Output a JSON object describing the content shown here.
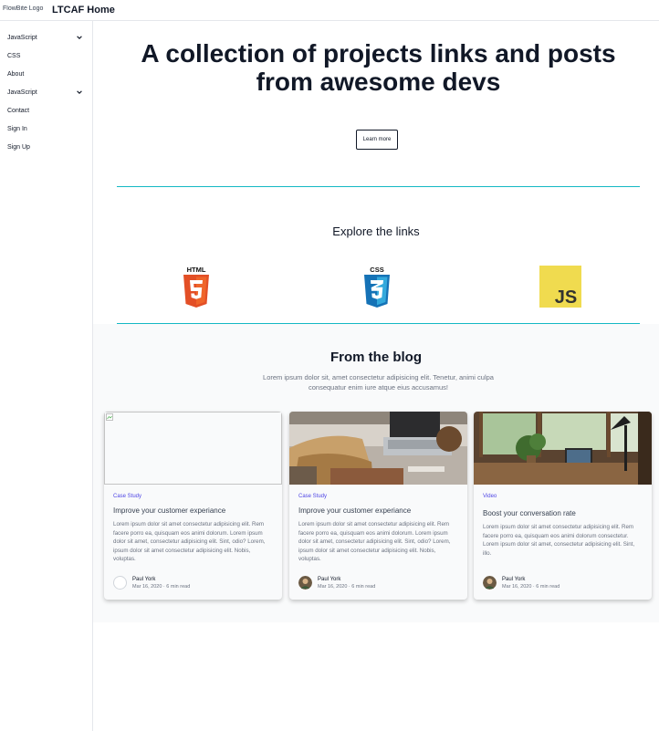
{
  "header": {
    "logo_alt": "FlowBite Logo",
    "brand": "LTCAF Home"
  },
  "sidebar": {
    "items": [
      {
        "label": "JavaScript",
        "has_chevron": true
      },
      {
        "label": "CSS"
      },
      {
        "label": "About"
      },
      {
        "label": "JavaScript",
        "has_chevron": true
      },
      {
        "label": "Contact"
      },
      {
        "label": "Sign In"
      },
      {
        "label": "Sign Up"
      }
    ]
  },
  "hero": {
    "title": "A collection of projects links and posts from awesome devs",
    "button_label": "Learn more"
  },
  "explore": {
    "heading": "Explore the links",
    "icons": [
      {
        "name": "html5-icon",
        "text": "HTML",
        "color": "#e34f26"
      },
      {
        "name": "css3-icon",
        "text": "CSS",
        "color": "#1572b6"
      },
      {
        "name": "js-icon",
        "text": "JS",
        "color": "#f0db4f"
      }
    ]
  },
  "blog": {
    "title": "From the blog",
    "subtitle": "Lorem ipsum dolor sit, amet consectetur adipisicing elit. Tenetur, animi culpa consequatur enim iure atque eius accusamus!",
    "posts": [
      {
        "category": "Case Study",
        "title": "Improve your customer experiance",
        "description": "Lorem ipsum dolor sit amet consectetur adipisicing elit. Rem facere porro ea, quisquam eos animi dolorum. Lorem ipsum dolor sit amet, consectetur adipisicing elit. Sint, odio? Lorem, ipsum dolor sit amet consectetur adipisicing elit. Nobis, voluptas.",
        "author": "Paul York",
        "meta": "Mar 16, 2020 · 6 min read"
      },
      {
        "category": "Case Study",
        "title": "Improve your customer experiance",
        "description": "Lorem ipsum dolor sit amet consectetur adipisicing elit. Rem facere porro ea, quisquam eos animi dolorum. Lorem ipsum dolor sit amet, consectetur adipisicing elit. Sint, odio? Lorem, ipsum dolor sit amet consectetur adipisicing elit. Nobis, voluptas.",
        "author": "Paul York",
        "meta": "Mar 16, 2020 · 6 min read"
      },
      {
        "category": "Video",
        "title": "Boost your conversation rate",
        "description": "Lorem ipsum dolor sit amet consectetur adipisicing elit. Rem facere porro ea, quisquam eos animi dolorum consectetur. Lorem ipsum dolor sit amet, consectetur adipisicing elit. Sint, illo.",
        "author": "Paul York",
        "meta": "Mar 16, 2020 · 6 min read"
      }
    ]
  },
  "colors": {
    "accent_line": "#14b8c4",
    "category": "#4f46e5",
    "section_bg": "#f9fafb"
  }
}
